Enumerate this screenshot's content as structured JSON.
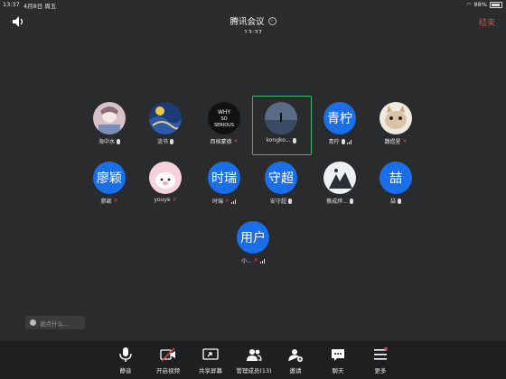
{
  "status_bar": {
    "time": "13:37",
    "date": "4月8日 周五",
    "battery": "88%"
  },
  "header": {
    "title": "腾讯会议",
    "time": "13:37",
    "end_label": "结束"
  },
  "participants": [
    {
      "name": "海中水",
      "avatar_text": "",
      "mic": "on"
    },
    {
      "name": "流书",
      "avatar_text": "",
      "mic": "on"
    },
    {
      "name": "西格蒙德",
      "avatar_text": "",
      "mic": "off"
    },
    {
      "name": "kongko...",
      "avatar_text": "",
      "mic": "on",
      "active": true
    },
    {
      "name": "青柠",
      "avatar_text": "青柠",
      "mic": "on"
    },
    {
      "name": "魏煜星",
      "avatar_text": "",
      "mic": "off"
    },
    {
      "name": "廖颖",
      "avatar_text": "廖颖",
      "mic": "off"
    },
    {
      "name": "youye",
      "avatar_text": "",
      "mic": "off"
    },
    {
      "name": "时瑞",
      "avatar_text": "时瑞",
      "mic": "off"
    },
    {
      "name": "安守超",
      "avatar_text": "守超",
      "mic": "on"
    },
    {
      "name": "蔡成烨...",
      "avatar_text": "",
      "mic": "on"
    },
    {
      "name": "喆",
      "avatar_text": "喆",
      "mic": "on"
    },
    {
      "name": "小...",
      "avatar_text": "用户",
      "mic": "off"
    }
  ],
  "chat": {
    "placeholder": "说点什么..."
  },
  "toolbar": {
    "mute": "静音",
    "video": "开启视频",
    "share": "共享屏幕",
    "members": "管理成员(13)",
    "invite": "邀请",
    "chat": "聊天",
    "more": "更多"
  },
  "colors": {
    "accent": "#1a6fe9",
    "danger": "#e4433b",
    "active_border": "#2fbb6a"
  }
}
